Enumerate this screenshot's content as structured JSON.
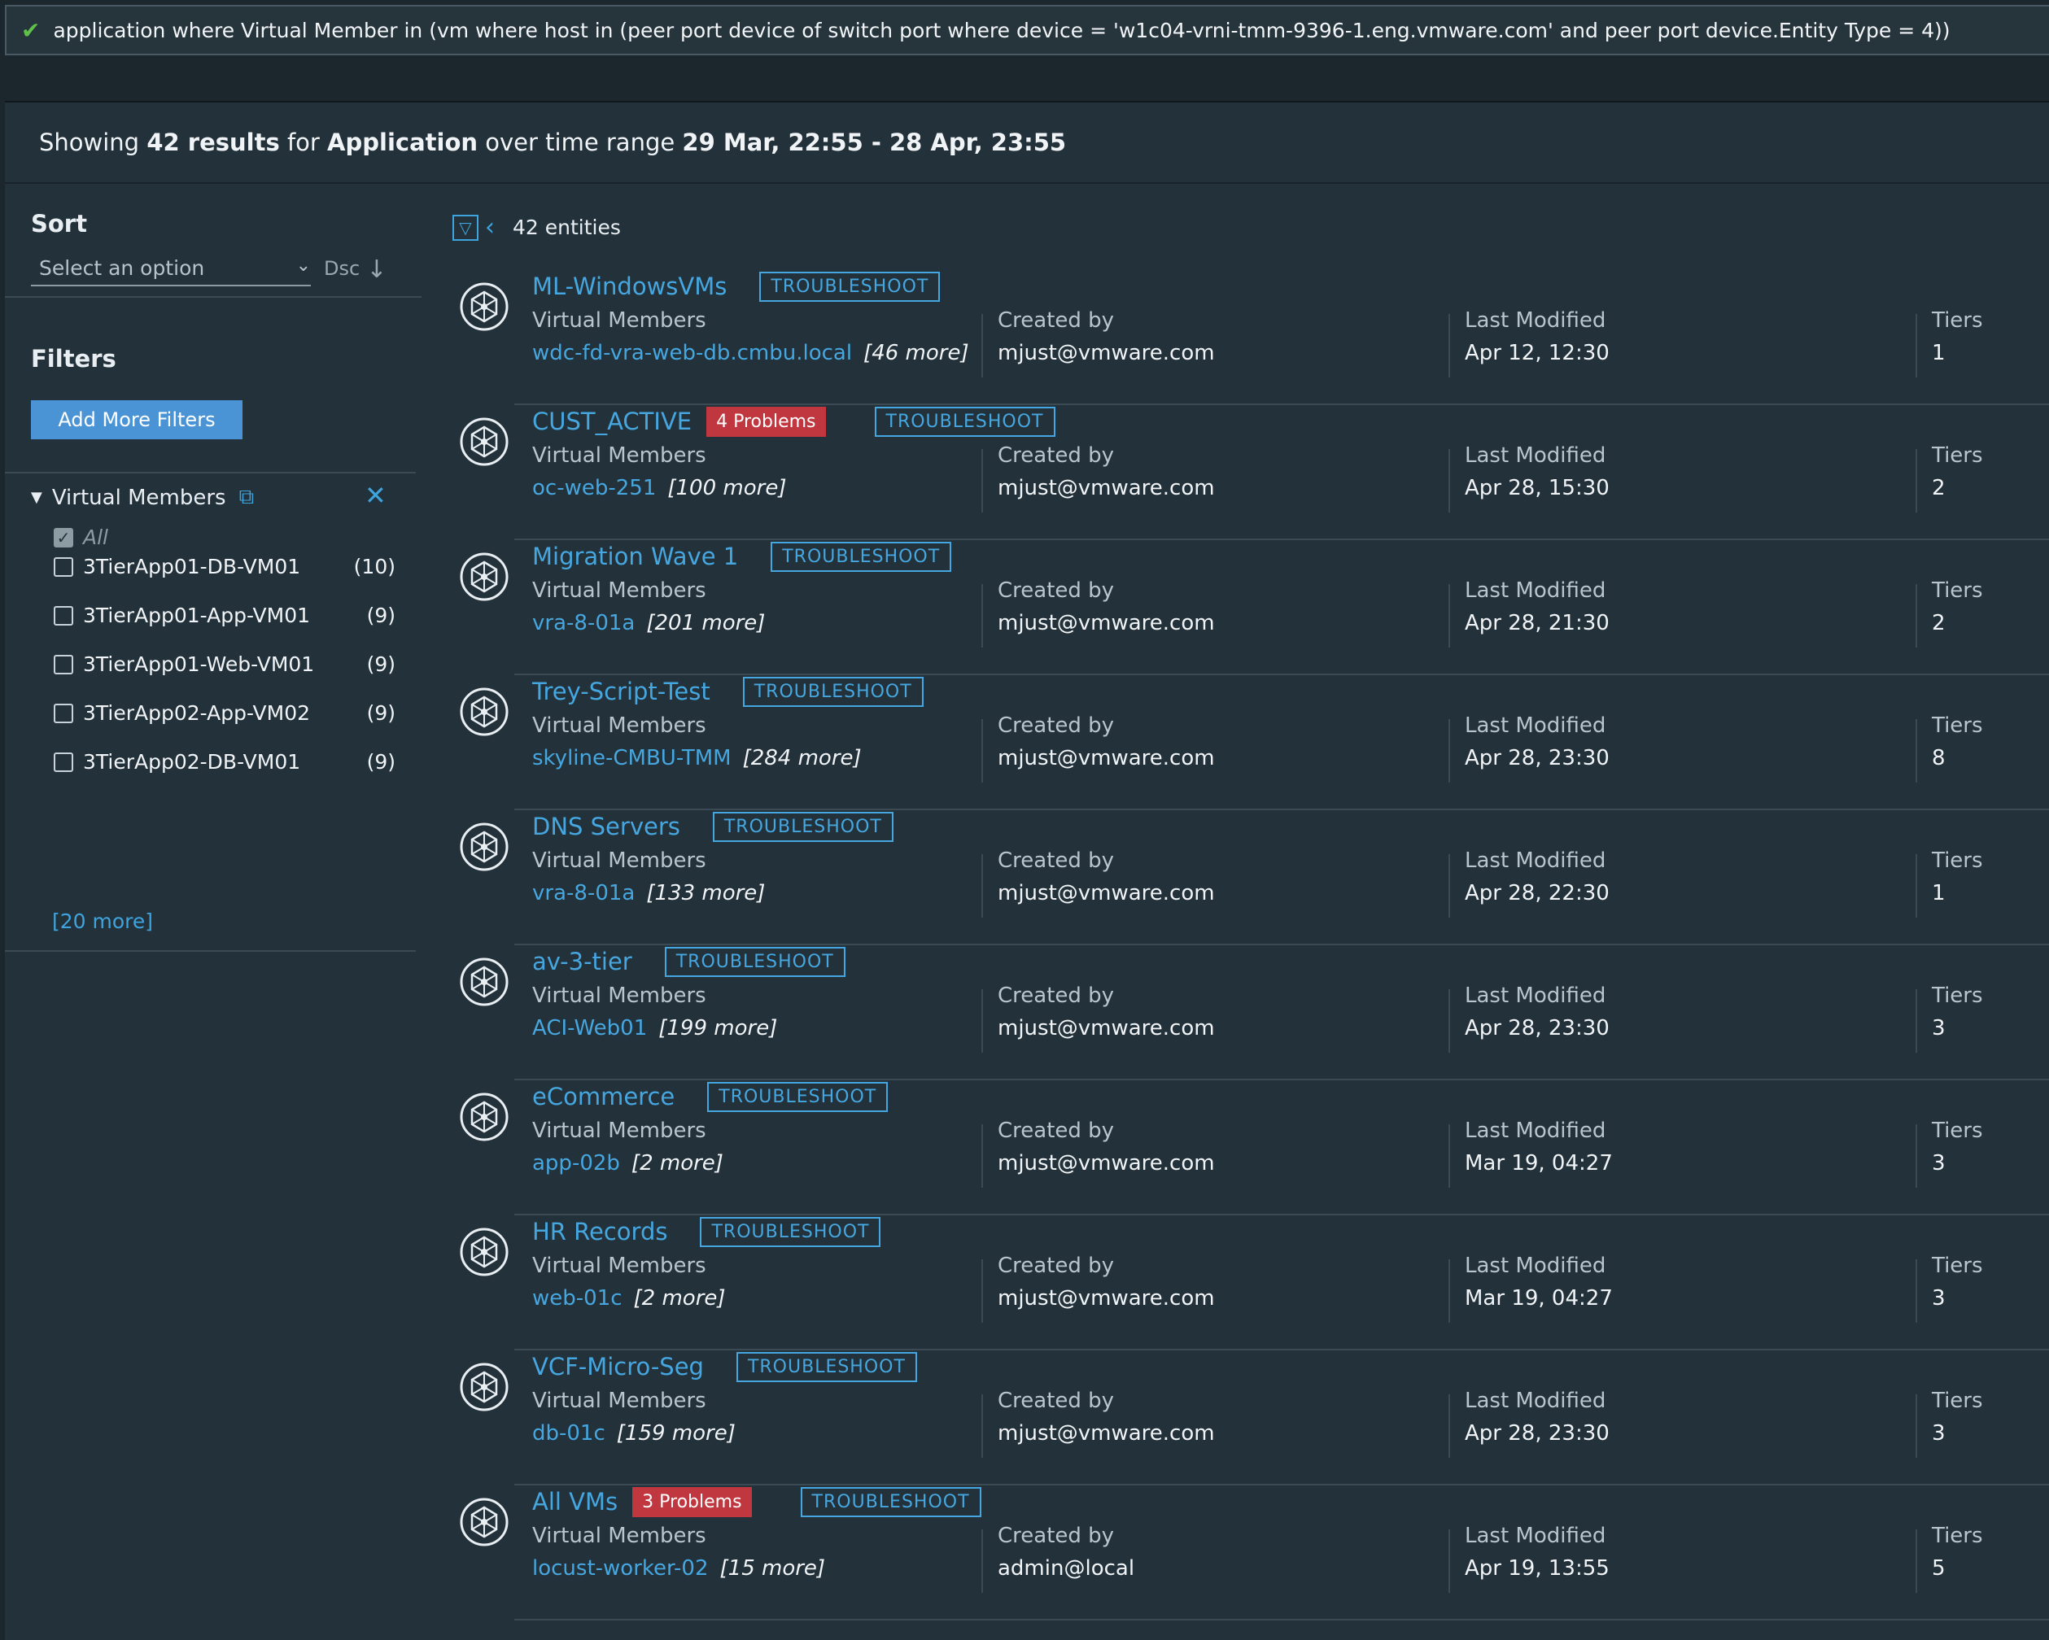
{
  "query": {
    "status_icon": "check-icon",
    "text": "application where Virtual Member in (vm where host in (peer port device of switch port where device =  'w1c04-vrni-tmm-9396-1.eng.vmware.com' and peer port device.Entity Type = 4))"
  },
  "header": {
    "prefix": "Showing",
    "count": "42 results",
    "mid1": "for",
    "entity": "Application",
    "mid2": "over time range",
    "range": "29 Mar, 22:55 - 28 Apr, 23:55"
  },
  "sidebar": {
    "sort_title": "Sort",
    "sort_placeholder": "Select an option",
    "sort_dir": "Dsc",
    "filters_title": "Filters",
    "add_filters_label": "Add More Filters",
    "vm_filter_title": "Virtual Members",
    "all_label": "All",
    "vm_items": [
      {
        "label": "3TierApp01-DB-VM01",
        "count": "(10)"
      },
      {
        "label": "3TierApp01-App-VM01",
        "count": "(9)"
      },
      {
        "label": "3TierApp01-Web-VM01",
        "count": "(9)"
      },
      {
        "label": "3TierApp02-App-VM02",
        "count": "(9)"
      },
      {
        "label": "3TierApp02-DB-VM01",
        "count": "(9)"
      }
    ],
    "more_label": "[20 more]"
  },
  "list": {
    "entities_label": "42 entities",
    "labels": {
      "members": "Virtual Members",
      "created": "Created by",
      "modified": "Last Modified",
      "tiers": "Tiers",
      "troubleshoot": "TROUBLESHOOT"
    },
    "rows": [
      {
        "name": "ML-WindowsVMs",
        "problems": "",
        "member": "wdc-fd-vra-web-db.cmbu.local",
        "more": "[46 more]",
        "created": "mjust@vmware.com",
        "modified": "Apr 12, 12:30",
        "tiers": "1"
      },
      {
        "name": "CUST_ACTIVE",
        "problems": "4 Problems",
        "member": "oc-web-251",
        "more": "[100 more]",
        "created": "mjust@vmware.com",
        "modified": "Apr 28, 15:30",
        "tiers": "2"
      },
      {
        "name": "Migration Wave 1",
        "problems": "",
        "member": "vra-8-01a",
        "more": "[201 more]",
        "created": "mjust@vmware.com",
        "modified": "Apr 28, 21:30",
        "tiers": "2"
      },
      {
        "name": "Trey-Script-Test",
        "problems": "",
        "member": "skyline-CMBU-TMM",
        "more": "[284 more]",
        "created": "mjust@vmware.com",
        "modified": "Apr 28, 23:30",
        "tiers": "8"
      },
      {
        "name": "DNS Servers",
        "problems": "",
        "member": "vra-8-01a",
        "more": "[133 more]",
        "created": "mjust@vmware.com",
        "modified": "Apr 28, 22:30",
        "tiers": "1"
      },
      {
        "name": "av-3-tier",
        "problems": "",
        "member": "ACI-Web01",
        "more": "[199 more]",
        "created": "mjust@vmware.com",
        "modified": "Apr 28, 23:30",
        "tiers": "3"
      },
      {
        "name": "eCommerce",
        "problems": "",
        "member": "app-02b",
        "more": "[2 more]",
        "created": "mjust@vmware.com",
        "modified": "Mar 19, 04:27",
        "tiers": "3"
      },
      {
        "name": "HR Records",
        "problems": "",
        "member": "web-01c",
        "more": "[2 more]",
        "created": "mjust@vmware.com",
        "modified": "Mar 19, 04:27",
        "tiers": "3"
      },
      {
        "name": "VCF-Micro-Seg",
        "problems": "",
        "member": "db-01c",
        "more": "[159 more]",
        "created": "mjust@vmware.com",
        "modified": "Apr 28, 23:30",
        "tiers": "3"
      },
      {
        "name": "All VMs",
        "problems": "3 Problems",
        "member": "locust-worker-02",
        "more": "[15 more]",
        "created": "admin@local",
        "modified": "Apr 19, 13:55",
        "tiers": "5"
      }
    ]
  }
}
